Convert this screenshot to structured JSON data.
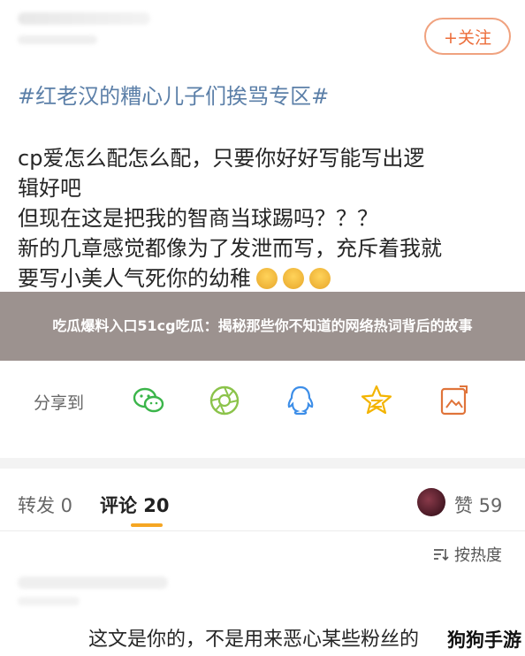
{
  "follow_button": {
    "label": "+关注"
  },
  "post": {
    "hashtag": "#红老汉的糟心儿子们挨骂专区#",
    "lines": [
      "cp爱怎么配怎么配，只要你好好写能写出逻",
      "辑好吧",
      "但现在这是把我的智商当球踢吗？？？",
      "新的几章感觉都像为了发泄而写，充斥着我就",
      "要写小美人气死你的幼稚"
    ]
  },
  "overlay": {
    "headline": "吃瓜爆料入口51cg吃瓜：揭秘那些你不知道的网络热词背后的故事"
  },
  "share": {
    "label": "分享到",
    "icons": [
      "wechat-icon",
      "moments-icon",
      "qq-icon",
      "qzone-icon",
      "image-share-icon"
    ],
    "accent": "#3bb54a"
  },
  "tabs": {
    "repost": "转发 0",
    "comments": "评论 20",
    "likes": "赞 59"
  },
  "sort": {
    "label": "按热度"
  },
  "comment": {
    "text": "这文是你的，不是用来恶心某些粉丝的"
  },
  "watermark": {
    "text": "狗狗手游"
  },
  "colors": {
    "follow": "#ec6d3a",
    "hashtag": "#5b7fa8",
    "tab_underline": "#f5a623",
    "overlay": "#8c807d"
  }
}
